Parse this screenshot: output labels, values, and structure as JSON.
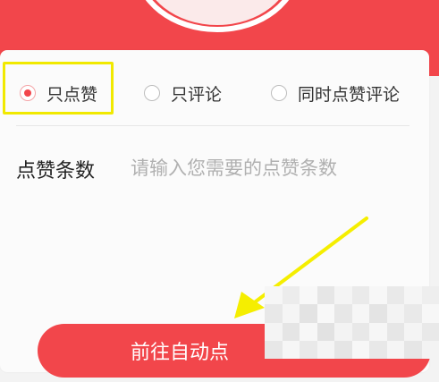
{
  "options": [
    {
      "label": "只点赞",
      "checked": true
    },
    {
      "label": "只评论",
      "checked": false
    },
    {
      "label": "同时点赞评论",
      "checked": false
    }
  ],
  "field": {
    "label": "点赞条数",
    "placeholder": "请输入您需要的点赞条数",
    "value": ""
  },
  "submit": {
    "label": "前往自动点"
  },
  "colors": {
    "accent": "#f2464b",
    "highlight": "#f1e900",
    "arrow": "#f5ee00"
  }
}
